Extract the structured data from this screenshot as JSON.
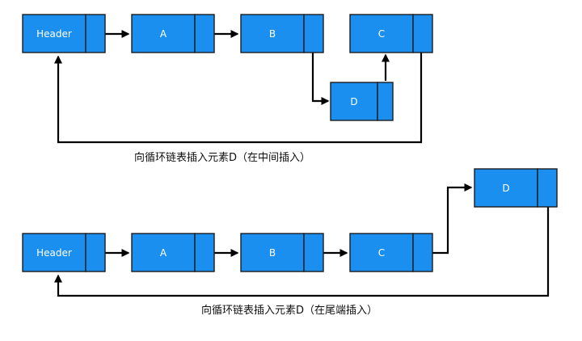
{
  "colors": {
    "node_fill": "#1a8ff0",
    "node_border": "#1c1c1c",
    "arrow": "#000000",
    "label_text": "#ffffff",
    "caption_text": "#111111"
  },
  "diagram_top": {
    "nodes": [
      "Header",
      "A",
      "B",
      "C",
      "D"
    ],
    "caption": "向循环链表插入元素D（在中间插入）"
  },
  "diagram_bottom": {
    "nodes": [
      "Header",
      "A",
      "B",
      "C",
      "D"
    ],
    "caption": "向循环链表插入元素D（在尾端插入）"
  }
}
